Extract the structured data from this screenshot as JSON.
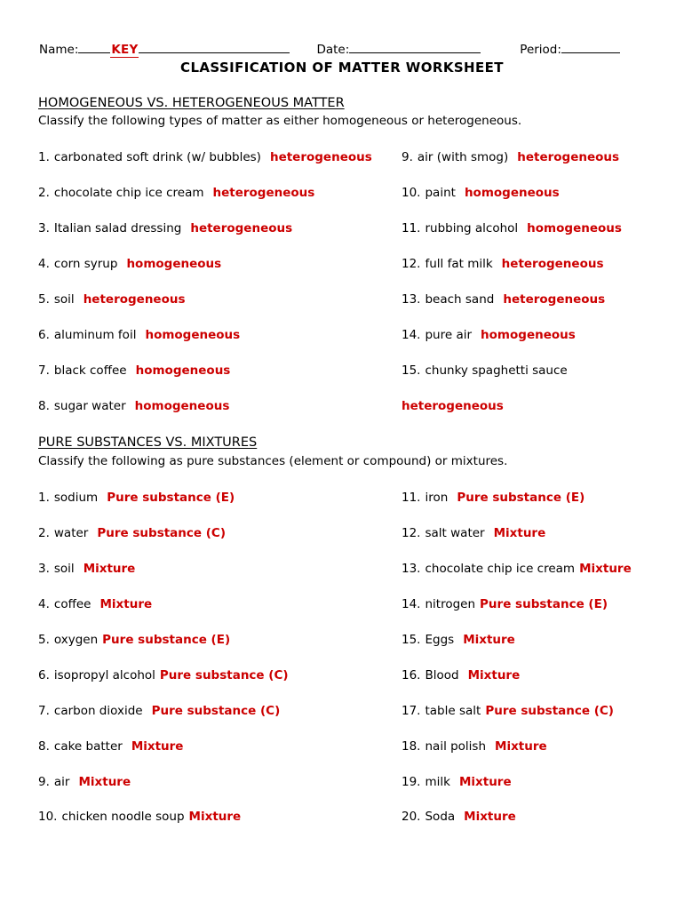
{
  "header": {
    "name_label": "Name:",
    "name_value": "KEY",
    "date_label": "Date:",
    "date_value": "",
    "period_label": "Period:",
    "period_value": "",
    "title": "CLASSIFICATION OF MATTER WORKSHEET"
  },
  "colors": {
    "answer_red": "#CC0000",
    "text_black": "#000000",
    "page_background": "#FFFFFF"
  },
  "sections": [
    {
      "heading": "HOMOGENEOUS VS. HETEROGENEOUS MATTER",
      "instruction": "Classify the following types of matter as either homogeneous or heterogeneous.",
      "left_items": [
        {
          "number": "1.",
          "prompt": "carbonated soft drink (w/ bubbles)",
          "answer": "heterogeneous"
        },
        {
          "number": "2.",
          "prompt": "chocolate chip ice cream",
          "answer": "heterogeneous"
        },
        {
          "number": "3.",
          "prompt": "Italian salad dressing",
          "answer": "heterogeneous"
        },
        {
          "number": "4.",
          "prompt": "corn syrup",
          "answer": "homogeneous"
        },
        {
          "number": "5.",
          "prompt": "soil",
          "answer": "heterogeneous"
        },
        {
          "number": "6.",
          "prompt": "aluminum foil",
          "answer": "homogeneous"
        },
        {
          "number": "7.",
          "prompt": "black coffee",
          "answer": "homogeneous"
        },
        {
          "number": "8.",
          "prompt": "sugar water",
          "answer": "homogeneous"
        }
      ],
      "right_items": [
        {
          "number": "9.",
          "prompt": "air (with smog)",
          "answer": "heterogeneous"
        },
        {
          "number": "10.",
          "prompt": "paint",
          "answer": "homogeneous"
        },
        {
          "number": "11.",
          "prompt": "rubbing alcohol",
          "answer": "homogeneous"
        },
        {
          "number": "12.",
          "prompt": "full fat milk",
          "answer": "heterogeneous"
        },
        {
          "number": "13.",
          "prompt": "beach sand",
          "answer": "heterogeneous"
        },
        {
          "number": "14.",
          "prompt": "pure air",
          "answer": "homogeneous"
        },
        {
          "number": "15.",
          "prompt": "chunky spaghetti sauce",
          "answer": "",
          "answer_next_line": "heterogeneous"
        }
      ]
    },
    {
      "heading": "PURE SUBSTANCES VS. MIXTURES",
      "instruction": "Classify the following as pure substances (element or compound) or mixtures.",
      "left_items": [
        {
          "number": "1.",
          "prompt": "sodium",
          "answer": "Pure substance (E)"
        },
        {
          "number": "2.",
          "prompt": "water",
          "answer": "Pure substance (C)"
        },
        {
          "number": "3.",
          "prompt": "soil",
          "answer": "Mixture"
        },
        {
          "number": "4.",
          "prompt": "coffee",
          "answer": "Mixture"
        },
        {
          "number": "5.",
          "prompt": "oxygen",
          "answer": "Pure substance (E)"
        },
        {
          "number": "6.",
          "prompt": "isopropyl alcohol",
          "answer": "Pure substance (C)"
        },
        {
          "number": "7.",
          "prompt": "carbon dioxide",
          "answer": "Pure substance (C)"
        },
        {
          "number": "8.",
          "prompt": "cake batter",
          "answer": "Mixture"
        },
        {
          "number": "9.",
          "prompt": "air",
          "answer": "Mixture"
        },
        {
          "number": "10.",
          "prompt": "chicken noodle soup",
          "answer": "Mixture"
        }
      ],
      "right_items": [
        {
          "number": "11.",
          "prompt": "iron",
          "answer": "Pure substance (E)"
        },
        {
          "number": "12.",
          "prompt": "salt water",
          "answer": "Mixture"
        },
        {
          "number": "13.",
          "prompt": "chocolate chip ice cream",
          "answer": "Mixture"
        },
        {
          "number": "14.",
          "prompt": "nitrogen",
          "answer": "Pure substance (E)"
        },
        {
          "number": "15.",
          "prompt": "Eggs",
          "answer": "Mixture"
        },
        {
          "number": "16.",
          "prompt": "Blood",
          "answer": "Mixture"
        },
        {
          "number": "17.",
          "prompt": "table salt",
          "answer": "Pure substance (C)"
        },
        {
          "number": "18.",
          "prompt": "nail polish",
          "answer": "Mixture"
        },
        {
          "number": "19.",
          "prompt": "milk",
          "answer": "Mixture"
        },
        {
          "number": "20.",
          "prompt": "Soda",
          "answer": "Mixture"
        }
      ]
    }
  ]
}
